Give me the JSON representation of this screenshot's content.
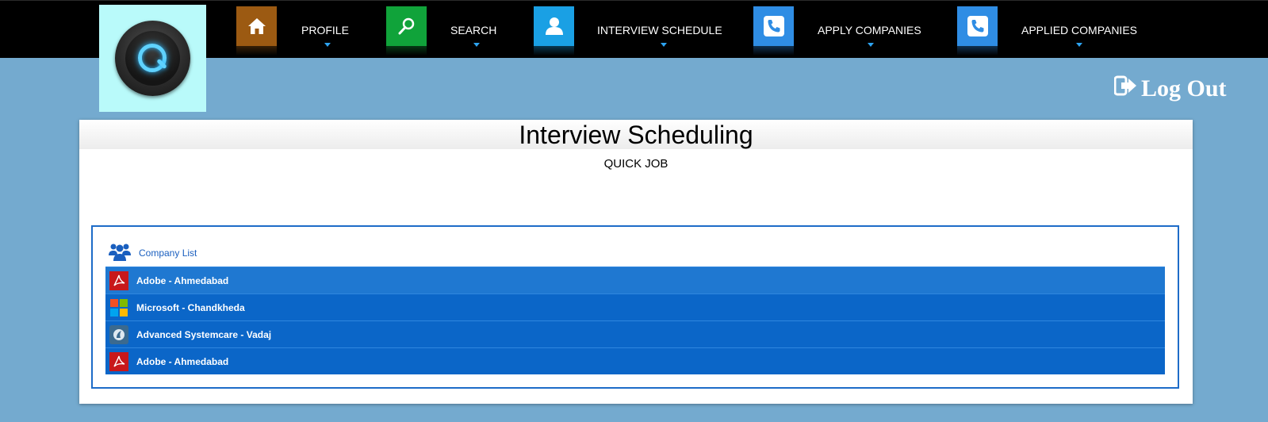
{
  "nav": {
    "items": [
      {
        "label": "PROFILE",
        "icon": "home-icon",
        "color": "#9c5a12"
      },
      {
        "label": "SEARCH",
        "icon": "search-icon",
        "color": "#10a33a"
      },
      {
        "label": "INTERVIEW SCHEDULE",
        "icon": "user-icon",
        "color": "#1aa0e4"
      },
      {
        "label": "APPLY COMPANIES",
        "icon": "phone-icon",
        "color": "#2f8de4"
      },
      {
        "label": "APPLIED COMPANIES",
        "icon": "phone-icon",
        "color": "#2f8de4"
      }
    ]
  },
  "logout": {
    "label": "Log Out",
    "icon": "sign-out-icon"
  },
  "panel": {
    "title": "Interview Scheduling",
    "subtitle": "QUICK JOB"
  },
  "company_list": {
    "header": "Company List",
    "header_icon": "users-icon",
    "rows": [
      {
        "label": "Adobe - Ahmedabad",
        "icon": "adobe-pdf-icon"
      },
      {
        "label": "Microsoft - Chandkheda",
        "icon": "microsoft-icon"
      },
      {
        "label": "Advanced Systemcare - Vadaj",
        "icon": "systemcare-icon"
      },
      {
        "label": "Adobe - Ahmedabad",
        "icon": "adobe-pdf-icon"
      }
    ]
  },
  "colors": {
    "background": "#74aacf",
    "topbar": "#000000",
    "row_blue": "#0b66c8",
    "accent_caret": "#2da3f0"
  }
}
